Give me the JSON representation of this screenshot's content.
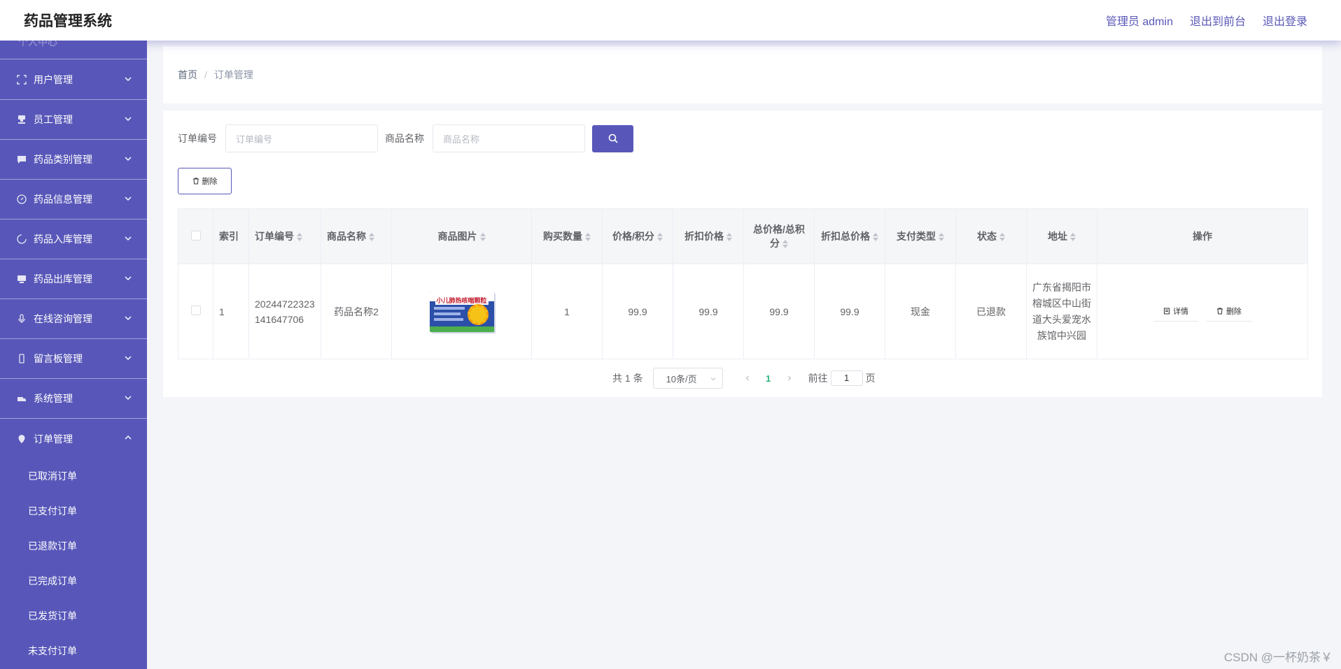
{
  "header": {
    "title": "药品管理系统",
    "admin_label": "管理员 admin",
    "to_front_label": "退出到前台",
    "logout_label": "退出登录"
  },
  "sidebar": {
    "partial_item": "个人中心",
    "items": [
      {
        "label": "用户管理",
        "icon": "fullscreen-icon"
      },
      {
        "label": "员工管理",
        "icon": "stamp-icon"
      },
      {
        "label": "药品类别管理",
        "icon": "chat-icon"
      },
      {
        "label": "药品信息管理",
        "icon": "compass-icon"
      },
      {
        "label": "药品入库管理",
        "icon": "loading-icon"
      },
      {
        "label": "药品出库管理",
        "icon": "monitor-icon"
      },
      {
        "label": "在线咨询管理",
        "icon": "microphone-icon"
      },
      {
        "label": "留言板管理",
        "icon": "mobile-icon"
      },
      {
        "label": "系统管理",
        "icon": "truck-icon"
      },
      {
        "label": "订单管理",
        "icon": "location-icon"
      }
    ],
    "order_subitems": [
      "已取消订单",
      "已支付订单",
      "已退款订单",
      "已完成订单",
      "已发货订单",
      "未支付订单"
    ]
  },
  "breadcrumb": {
    "home": "首页",
    "separator": "/",
    "current": "订单管理"
  },
  "search": {
    "order_no_label": "订单编号",
    "order_no_placeholder": "订单编号",
    "product_label": "商品名称",
    "product_placeholder": "商品名称"
  },
  "toolbar": {
    "delete_label": "删除"
  },
  "table": {
    "columns": [
      "索引",
      "订单编号",
      "商品名称",
      "商品图片",
      "购买数量",
      "价格/积分",
      "折扣价格",
      "总价格/总积分",
      "折扣总价格",
      "支付类型",
      "状态",
      "地址",
      "操作"
    ],
    "rows": [
      {
        "index": "1",
        "order_no": "20244722323141647706",
        "product_name": "药品名称2",
        "image_text": "小儿肺热咳喘颗粒",
        "quantity": "1",
        "price": "99.9",
        "discount_price": "99.9",
        "total_price": "99.9",
        "discount_total": "99.9",
        "pay_type": "现金",
        "status": "已退款",
        "address": "广东省揭阳市榕城区中山街道大头爱宠水族馆中兴园",
        "detail_label": "详情",
        "delete_label": "删除"
      }
    ]
  },
  "pagination": {
    "total_text": "共 1 条",
    "page_size": "10条/页",
    "current_page": "1",
    "goto_label": "前往",
    "goto_value": "1",
    "page_suffix": "页"
  },
  "watermark": "CSDN @一杯奶茶￥",
  "colors": {
    "primary": "#5857b9",
    "active_page": "#2fb67e"
  }
}
